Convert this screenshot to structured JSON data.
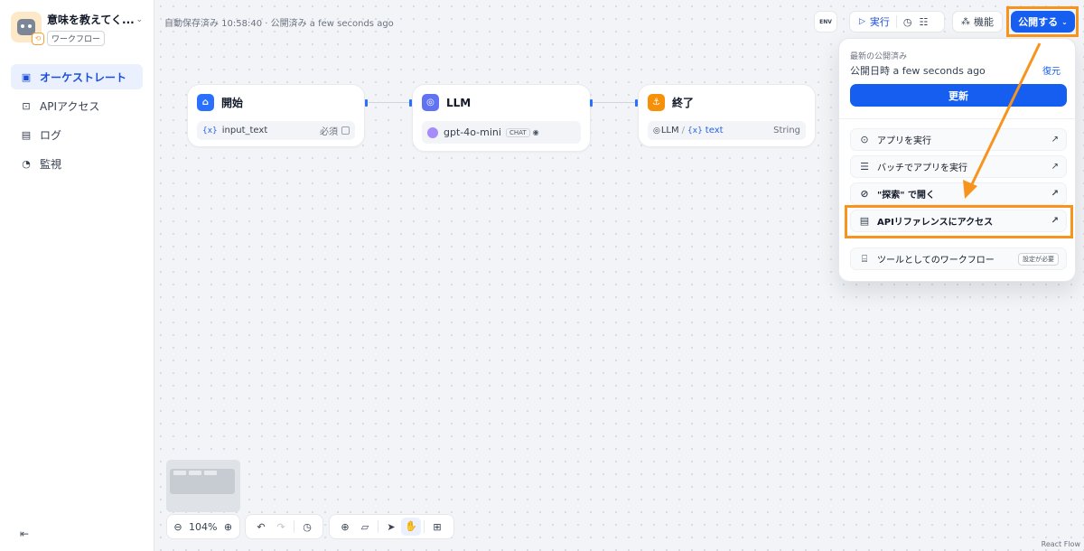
{
  "app": {
    "title": "意味を教えてく...",
    "type_label": "ワークフロー"
  },
  "sidebar": {
    "items": [
      {
        "label": "オーケストレート",
        "icon": "orchestrate-icon",
        "active": true
      },
      {
        "label": "APIアクセス",
        "icon": "terminal-icon",
        "active": false
      },
      {
        "label": "ログ",
        "icon": "document-icon",
        "active": false
      },
      {
        "label": "監視",
        "icon": "gauge-icon",
        "active": false
      }
    ]
  },
  "header": {
    "autosave_text": "自動保存済み 10:58:40 · 公開済み a few seconds ago",
    "env_label": "ENV",
    "run_label": "実行",
    "features_label": "機能",
    "publish_label": "公開する"
  },
  "nodes": {
    "start": {
      "title": "開始",
      "var_name": "input_text",
      "required": "必須"
    },
    "llm": {
      "title": "LLM",
      "model": "gpt-4o-mini",
      "mode": "CHAT"
    },
    "end": {
      "title": "終了",
      "source": "LLM",
      "var_name": "text",
      "var_type": "String"
    }
  },
  "publish_menu": {
    "latest_label": "最新の公開済み",
    "published_time": "公開日時 a few seconds ago",
    "restore_label": "復元",
    "update_label": "更新",
    "items": [
      {
        "label": "アプリを実行",
        "icon": "play-circle-icon"
      },
      {
        "label": "バッチでアプリを実行",
        "icon": "batch-list-icon"
      },
      {
        "label": "\"探索\" で開く",
        "icon": "compass-icon"
      },
      {
        "label": "APIリファレンスにアクセス",
        "icon": "file-icon"
      }
    ],
    "tool_item": {
      "label": "ツールとしてのワークフロー",
      "tag": "設定が必要"
    }
  },
  "zoom": {
    "value": "104%"
  },
  "attribution": "React Flow",
  "colors": {
    "accent": "#155eef",
    "annotation": "#f7941d"
  }
}
